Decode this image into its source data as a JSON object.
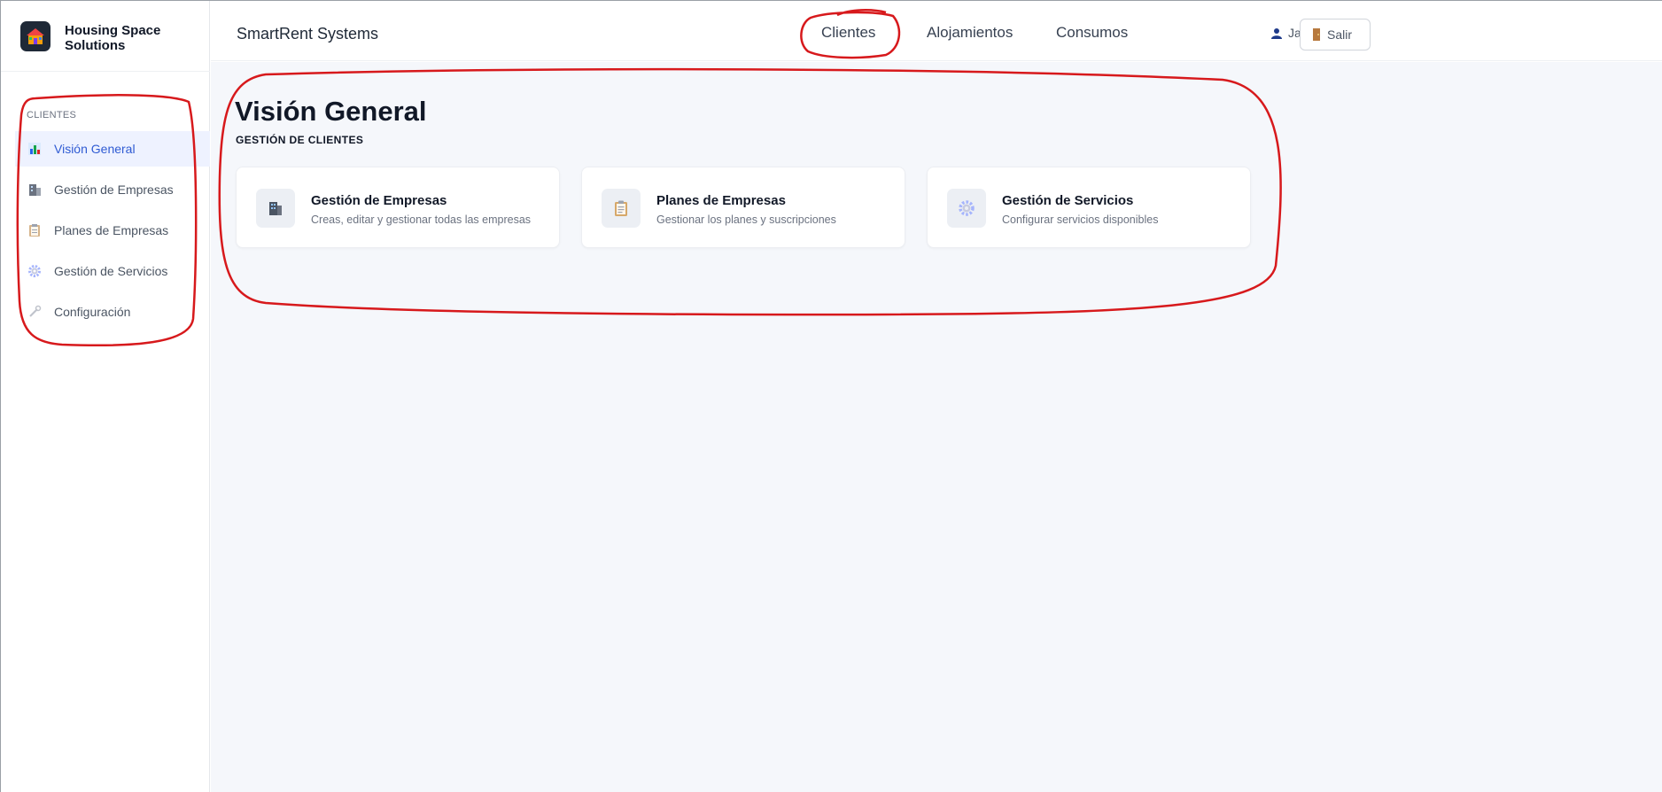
{
  "brand": {
    "name": "Housing Space Solutions",
    "logo_icon": "house-icon"
  },
  "header": {
    "system_title": "SmartRent Systems",
    "nav": [
      "Clientes",
      "Alojamientos",
      "Consumos"
    ],
    "user_name": "Javier",
    "logout_label": "Salir"
  },
  "sidebar": {
    "section_label": "CLIENTES",
    "items": [
      {
        "label": "Visión General",
        "icon": "bar-chart-icon",
        "active": true
      },
      {
        "label": "Gestión de Empresas",
        "icon": "building-icon",
        "active": false
      },
      {
        "label": "Planes de Empresas",
        "icon": "clipboard-icon",
        "active": false
      },
      {
        "label": "Gestión de Servicios",
        "icon": "gear-icon",
        "active": false
      },
      {
        "label": "Configuración",
        "icon": "wrench-icon",
        "active": false
      }
    ]
  },
  "main": {
    "title": "Visión General",
    "subtitle": "GESTIÓN DE CLIENTES",
    "cards": [
      {
        "title": "Gestión de Empresas",
        "description": "Creas, editar y gestionar todas las empresas",
        "icon": "building-icon"
      },
      {
        "title": "Planes de Empresas",
        "description": "Gestionar los planes y suscripciones",
        "icon": "clipboard-icon"
      },
      {
        "title": "Gestión de Servicios",
        "description": "Configurar servicios disponibles",
        "icon": "gear-icon"
      }
    ]
  },
  "colors": {
    "accent": "#2f5bd3",
    "annotation": "#d7191c",
    "background": "#f5f7fb"
  }
}
